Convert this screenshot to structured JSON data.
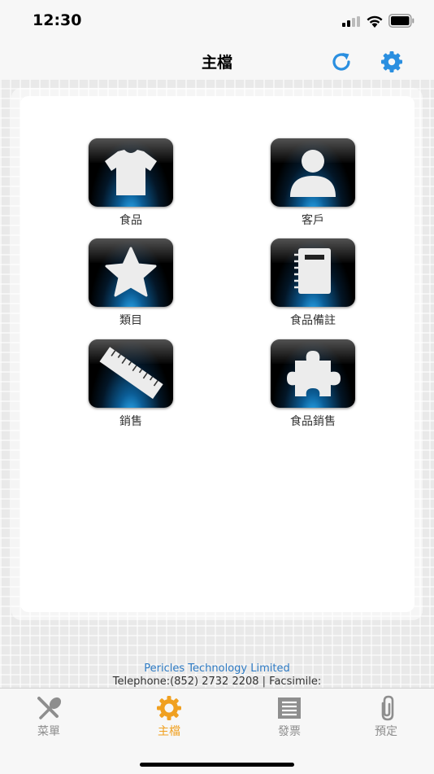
{
  "status_bar": {
    "time": "12:30"
  },
  "nav": {
    "title": "主檔",
    "refresh_icon": "refresh-icon",
    "settings_icon": "gear-icon",
    "accent_color": "#2a8fe0"
  },
  "tiles": [
    {
      "label": "食品",
      "icon": "shirt-icon"
    },
    {
      "label": "客戶",
      "icon": "person-icon"
    },
    {
      "label": "類目",
      "icon": "star-icon"
    },
    {
      "label": "食品備註",
      "icon": "notebook-icon"
    },
    {
      "label": "銷售",
      "icon": "ruler-icon"
    },
    {
      "label": "食品銷售",
      "icon": "puzzle-icon"
    }
  ],
  "footer": {
    "company": "Pericles Technology Limited",
    "contact": "Telephone:(852) 2732 2208 | Facsimile:"
  },
  "tab_bar": {
    "active_color": "#f0a020",
    "inactive_color": "#8e8e8e",
    "tabs": [
      {
        "label": "菜單",
        "icon": "utensils-icon",
        "active": false
      },
      {
        "label": "主檔",
        "icon": "gear-sun-icon",
        "active": true
      },
      {
        "label": "發票",
        "icon": "receipt-icon",
        "active": false
      },
      {
        "label": "預定",
        "icon": "paperclip-icon",
        "active": false
      }
    ]
  }
}
